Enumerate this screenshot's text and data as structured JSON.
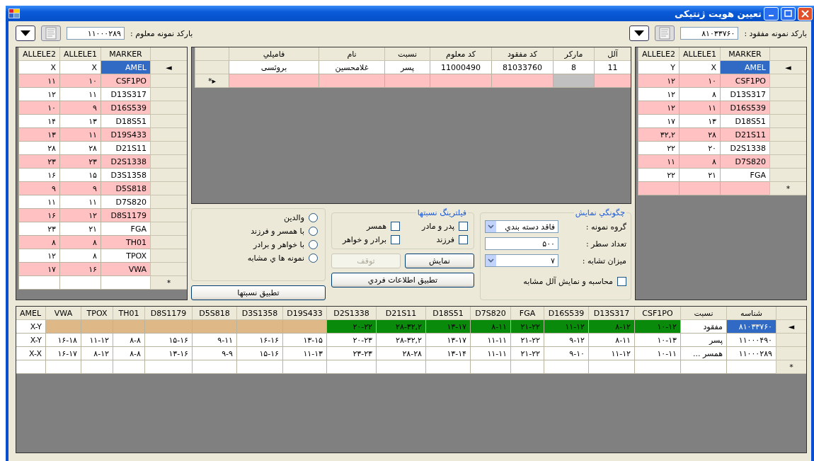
{
  "window": {
    "title": "تعیین هویت ژنتیکی"
  },
  "missing_sample": {
    "label": "بارکد نمونه مفقود :",
    "barcode": "۸۱۰۳۳۷۶۰"
  },
  "known_sample": {
    "label": "بارکد نمونه معلوم :",
    "barcode": "۱۱۰۰۰۲۸۹"
  },
  "missing_grid": {
    "columns": [
      "MARKER",
      "ALLELE1",
      "ALLELE2"
    ],
    "rows": [
      {
        "indicator": "◄",
        "selected": true,
        "cells": [
          "AMEL",
          "X",
          "Y"
        ]
      },
      {
        "selected": false,
        "cells": [
          "CSF1PO",
          "۱۰",
          "۱۲"
        ]
      },
      {
        "selected": false,
        "cells": [
          "D13S317",
          "۸",
          "۱۲"
        ]
      },
      {
        "selected": false,
        "cells": [
          "D16S539",
          "۱۱",
          "۱۲"
        ]
      },
      {
        "selected": false,
        "cells": [
          "D18S51",
          "۱۳",
          "۱۷"
        ]
      },
      {
        "selected": false,
        "cells": [
          "D21S11",
          "۲۸",
          "۳۲,۲"
        ]
      },
      {
        "selected": false,
        "cells": [
          "D2S1338",
          "۲۰",
          "۲۲"
        ]
      },
      {
        "selected": false,
        "cells": [
          "D7S820",
          "۸",
          "۱۱"
        ]
      },
      {
        "selected": false,
        "cells": [
          "FGA",
          "۲۱",
          "۲۲"
        ]
      }
    ],
    "new_row": {
      "indicator": "*"
    }
  },
  "matches_grid": {
    "columns": [
      "آلل",
      {
        "title": "مارکر",
        "readonly": true
      },
      "کد مفقود",
      "کد معلوم",
      "نسبت",
      "نام",
      "فاميلي"
    ],
    "rows": [
      {
        "cells": [
          "11",
          "8",
          "81033760",
          "11000490",
          "پسر",
          "غلامحسین",
          "بروئسی"
        ]
      }
    ],
    "new_row": {
      "indicator": "▸*"
    }
  },
  "known_grid": {
    "columns": [
      "MARKER",
      "ALLELE1",
      "ALLELE2"
    ],
    "rows": [
      {
        "indicator": "◄",
        "selected": true,
        "cells": [
          "AMEL",
          "X",
          "X"
        ]
      },
      {
        "selected": false,
        "cells": [
          "CSF1PO",
          "۱۰",
          "۱۱"
        ]
      },
      {
        "selected": false,
        "cells": [
          "D13S317",
          "۱۱",
          "۱۲"
        ]
      },
      {
        "selected": false,
        "cells": [
          "D16S539",
          "۹",
          "۱۰"
        ]
      },
      {
        "selected": false,
        "cells": [
          "D18S51",
          "۱۳",
          "۱۴"
        ]
      },
      {
        "selected": false,
        "cells": [
          "D19S433",
          "۱۱",
          "۱۳"
        ]
      },
      {
        "selected": false,
        "cells": [
          "D21S11",
          "۲۸",
          "۲۸"
        ]
      },
      {
        "selected": false,
        "cells": [
          "D2S1338",
          "۲۳",
          "۲۳"
        ]
      },
      {
        "selected": false,
        "cells": [
          "D3S1358",
          "۱۵",
          "۱۶"
        ]
      },
      {
        "selected": false,
        "cells": [
          "D5S818",
          "۹",
          "۹"
        ]
      },
      {
        "selected": false,
        "cells": [
          "D7S820",
          "۱۱",
          "۱۱"
        ]
      },
      {
        "selected": false,
        "cells": [
          "D8S1179",
          "۱۲",
          "۱۶"
        ]
      },
      {
        "selected": false,
        "cells": [
          "FGA",
          "۲۱",
          "۲۳"
        ]
      },
      {
        "selected": false,
        "cells": [
          "TH01",
          "۸",
          "۸"
        ]
      },
      {
        "selected": false,
        "cells": [
          "TPOX",
          "۸",
          "۱۲"
        ]
      },
      {
        "selected": false,
        "cells": [
          "VWA",
          "۱۶",
          "۱۷"
        ]
      }
    ],
    "new_row": {
      "indicator": "*"
    }
  },
  "display_options": {
    "title": "چگونگي نمايش",
    "sample_group": {
      "label": "گروه نمونه :",
      "value": "فاقد دسته بندي"
    },
    "row_count": {
      "label": "تعداد سطر :",
      "value": "۵۰۰"
    },
    "similarity": {
      "label": "میزان تشابه :",
      "value": "۷"
    },
    "show_similar_alleles": {
      "label": "محاسبه و نمایش آلل مشابه",
      "checked": false
    }
  },
  "relation_filter": {
    "title": "فیلترینگ نسبتها",
    "options": [
      {
        "label": "پدر و مادر",
        "checked": false
      },
      {
        "label": "همسر",
        "checked": false
      },
      {
        "label": "فرزند",
        "checked": false
      },
      {
        "label": "برادر و خواهر",
        "checked": false
      }
    ]
  },
  "actions": [
    {
      "label": "نمایش",
      "disabled": false
    },
    {
      "label": "توقف",
      "disabled": true
    },
    {
      "label": "تطبیق اطلاعات فردي",
      "disabled": false
    }
  ],
  "relation_modes": {
    "options": [
      {
        "label": "والدین",
        "selected": false
      },
      {
        "label": "با همسر و فرزند",
        "selected": false
      },
      {
        "label": "با خواهر و برادر",
        "selected": false
      },
      {
        "label": "نمونه ها ي مشابه",
        "selected": false
      }
    ]
  },
  "match_relations_button": {
    "label": "تطبیق نسبتها"
  },
  "comparison_grid": {
    "columns": [
      "شناسه",
      "نسبت",
      "CSF1PO",
      "D13S317",
      "D16S539",
      "FGA",
      "D7S820",
      "D18S51",
      "D21S11",
      "D2S1338",
      "D19S433",
      "D3S1358",
      "D5S818",
      "D8S1179",
      "TH01",
      "TPOX",
      "VWA",
      "AMEL"
    ],
    "rows": [
      {
        "indicator": "◄",
        "selected": true,
        "cells": [
          {
            "text": "۸۱۰۳۳۷۶۰"
          },
          {
            "text": "مفقود"
          },
          {
            "text": "۱۰-۱۲",
            "color": "#0a8a0a"
          },
          {
            "text": "۸-۱۲",
            "color": "#0a8a0a"
          },
          {
            "text": "۱۱-۱۲",
            "color": "#0a8a0a"
          },
          {
            "text": "۲۱-۲۲",
            "color": "#0a8a0a"
          },
          {
            "text": "۸-۱۱",
            "color": "#0a8a0a"
          },
          {
            "text": "۱۳-۱۷",
            "color": "#0a8a0a"
          },
          {
            "text": "۲۸-۳۲,۲",
            "color": "#0a8a0a"
          },
          {
            "text": "۲۰-۲۲",
            "color": "#0a8a0a"
          },
          {
            "color": "#deb887"
          },
          {
            "color": "#deb887"
          },
          {
            "color": "#deb887"
          },
          {
            "color": "#deb887"
          },
          {
            "color": "#deb887"
          },
          {
            "color": "#deb887"
          },
          {
            "color": "#deb887"
          },
          {
            "text": "X-Y"
          }
        ]
      },
      {
        "selected": false,
        "cells": [
          "۱۱۰۰۰۴۹۰",
          "پسر",
          "۱۰-۱۳",
          "۸-۱۱",
          "۹-۱۲",
          "۲۱-۲۲",
          "۱۱-۱۱",
          "۱۳-۱۷",
          "۲۸-۳۲,۲",
          "۲۰-۲۳",
          "۱۳-۱۵",
          "۱۶-۱۶",
          "۹-۱۱",
          "۱۵-۱۶",
          "۸-۸",
          "۱۱-۱۲",
          "۱۶-۱۸",
          "X-Y"
        ]
      },
      {
        "selected": false,
        "cells": [
          "۱۱۰۰۰۲۸۹",
          "همسر ...",
          "۱۰-۱۱",
          "۱۱-۱۲",
          "۹-۱۰",
          "۲۱-۲۲",
          "۱۱-۱۱",
          "۱۳-۱۴",
          "۲۸-۲۸",
          "۲۳-۲۳",
          "۱۱-۱۳",
          "۱۵-۱۶",
          "۹-۹",
          "۱۳-۱۶",
          "۸-۸",
          "۸-۱۲",
          "۱۶-۱۷",
          "X-X"
        ]
      }
    ],
    "new_row": {
      "indicator": "*"
    }
  }
}
